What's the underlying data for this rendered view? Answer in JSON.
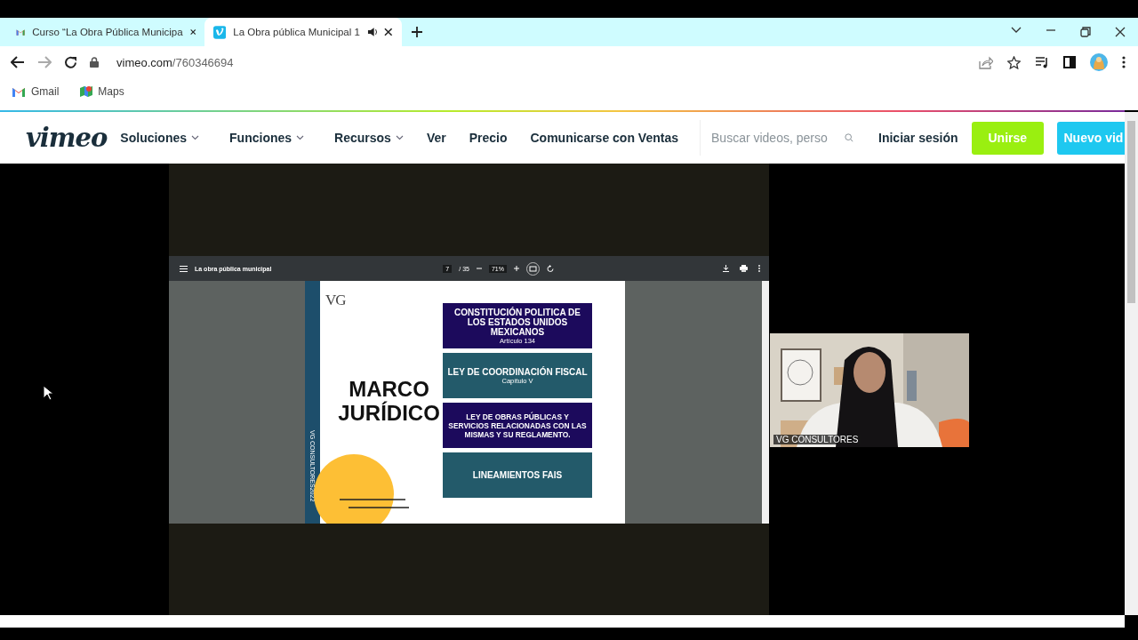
{
  "browser": {
    "tabs": [
      {
        "title": "Curso “La Obra Pública Municipa",
        "selected": false,
        "kind": "mail",
        "audio": false
      },
      {
        "title": "La Obra pública Municipal 1",
        "selected": true,
        "kind": "video",
        "audio": true
      }
    ],
    "address": {
      "host": "vimeo.com",
      "path": "/760346694"
    },
    "bookmarks": [
      {
        "label": "Gmail",
        "kind": "mail"
      },
      {
        "label": "Maps",
        "kind": "map"
      }
    ]
  },
  "site": {
    "logo": "vimeo",
    "nav": [
      {
        "label": "Soluciones",
        "dropdown": true
      },
      {
        "label": "Funciones",
        "dropdown": true
      },
      {
        "label": "Recursos",
        "dropdown": true
      },
      {
        "label": "Ver",
        "dropdown": false
      },
      {
        "label": "Precio",
        "dropdown": false
      },
      {
        "label": "Comunicarse con Ventas",
        "dropdown": false
      }
    ],
    "search": {
      "placeholder": "Buscar videos, perso"
    },
    "login": "Iniciar sesión",
    "buttons": [
      {
        "label": "Unirse",
        "kind": "join"
      },
      {
        "label": "Nuevo vid",
        "kind": "upload"
      }
    ]
  },
  "video": {
    "viewer": {
      "title": "La obra pública municipal",
      "page": "7",
      "pages": "/ 35",
      "zoom": "71%"
    },
    "slide": {
      "logo": "VG",
      "title": "MARCO JURÍDICO",
      "side_text": "VG CONSULTORES2022",
      "boxes": [
        {
          "title": "CONSTITUCIÓN POLITICA DE LOS ESTADOS UNIDOS MEXICANOS",
          "subtitle": "Artículo 134",
          "color": "#1c0a5c"
        },
        {
          "title": "LEY DE COORDINACIÓN FISCAL",
          "subtitle": "Capítulo V",
          "color": "#235a6a"
        },
        {
          "title": "LEY DE OBRAS PÚBLICAS Y SERVICIOS RELACIONADAS CON LAS MISMAS Y SU REGLAMENTO.",
          "color": "#1c0a5c"
        },
        {
          "title": "LINEAMIENTOS FAIS",
          "color": "#235a6a"
        }
      ]
    },
    "camera": {
      "label": "VG CONSULTORES"
    }
  }
}
